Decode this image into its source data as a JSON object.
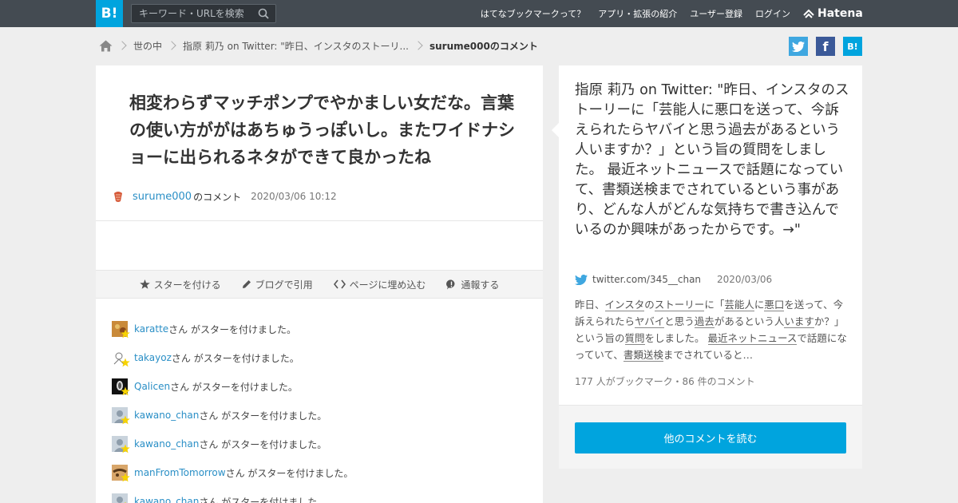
{
  "header": {
    "logo_text": "B!",
    "search_placeholder": "キーワード・URLを検索",
    "nav": [
      "はてなブックマークって？",
      "アプリ・拡張の紹介",
      "ユーザー登録",
      "ログイン"
    ],
    "hatena_brand": "Hatena"
  },
  "breadcrumb": {
    "items": [
      "世の中",
      "指原 莉乃 on Twitter: \"昨日、インスタのストーリ..."
    ],
    "current": "surume000のコメント"
  },
  "share": {
    "twitter_icon": "twitter-icon",
    "facebook_label": "f",
    "hatena_label": "B!"
  },
  "comment": {
    "text": "相変わらずマッチポンプでやかましい女だな。言葉の使い方ががはあちゅうっぽいし。またワイドナショーに出られるネタができて良かったね",
    "username": "surume000",
    "user_suffix": "のコメント",
    "date": "2020/03/06 10:12"
  },
  "actions": [
    {
      "label": "スターを付ける",
      "icon": "star-icon"
    },
    {
      "label": "ブログで引用",
      "icon": "pencil-icon"
    },
    {
      "label": "ページに埋め込む",
      "icon": "code-icon"
    },
    {
      "label": "通報する",
      "icon": "alert-icon"
    }
  ],
  "stars": {
    "suffix": "さん がスターを付けました。",
    "users": [
      "karatte",
      "takayoz",
      "Qalicen",
      "kawano_chan",
      "kawano_chan",
      "manFromTomorrow",
      "kawano_chan"
    ]
  },
  "entry": {
    "title": "指原 莉乃 on Twitter: \"昨日、インスタのストーリーに「芸能人に悪口を送って、今訴えられたらヤバイと思う過去があるという人いますか？」という旨の質問をしました。 最近ネットニュースで話題になっていて、書類送検までされているという事があり、どんな人がどんな気持ちで書き込んでいるのか興味があったからです。→\"",
    "source": "twitter.com/345__chan",
    "date": "2020/03/06",
    "summary": [
      "昨日、",
      "インスタ",
      "の",
      "ストーリー",
      "に「",
      "芸能人",
      "に",
      "悪口",
      "を送って、今訴えられたら",
      "ヤバイ",
      "と思う",
      "過去",
      "があるという人",
      "います",
      "か？」という旨の",
      "質問",
      "をしました。 ",
      "最近ネットニュース",
      "で話題になっていて、",
      "書類送検",
      "までされていると…"
    ],
    "stats": "177 人がブックマーク・86 件のコメント",
    "read_button": "他のコメントを読む"
  },
  "colors": {
    "header_bg": "#444b52",
    "brand_blue": "#00a4de",
    "link_blue": "#2a8fc6",
    "star_yellow": "#f7d300"
  }
}
